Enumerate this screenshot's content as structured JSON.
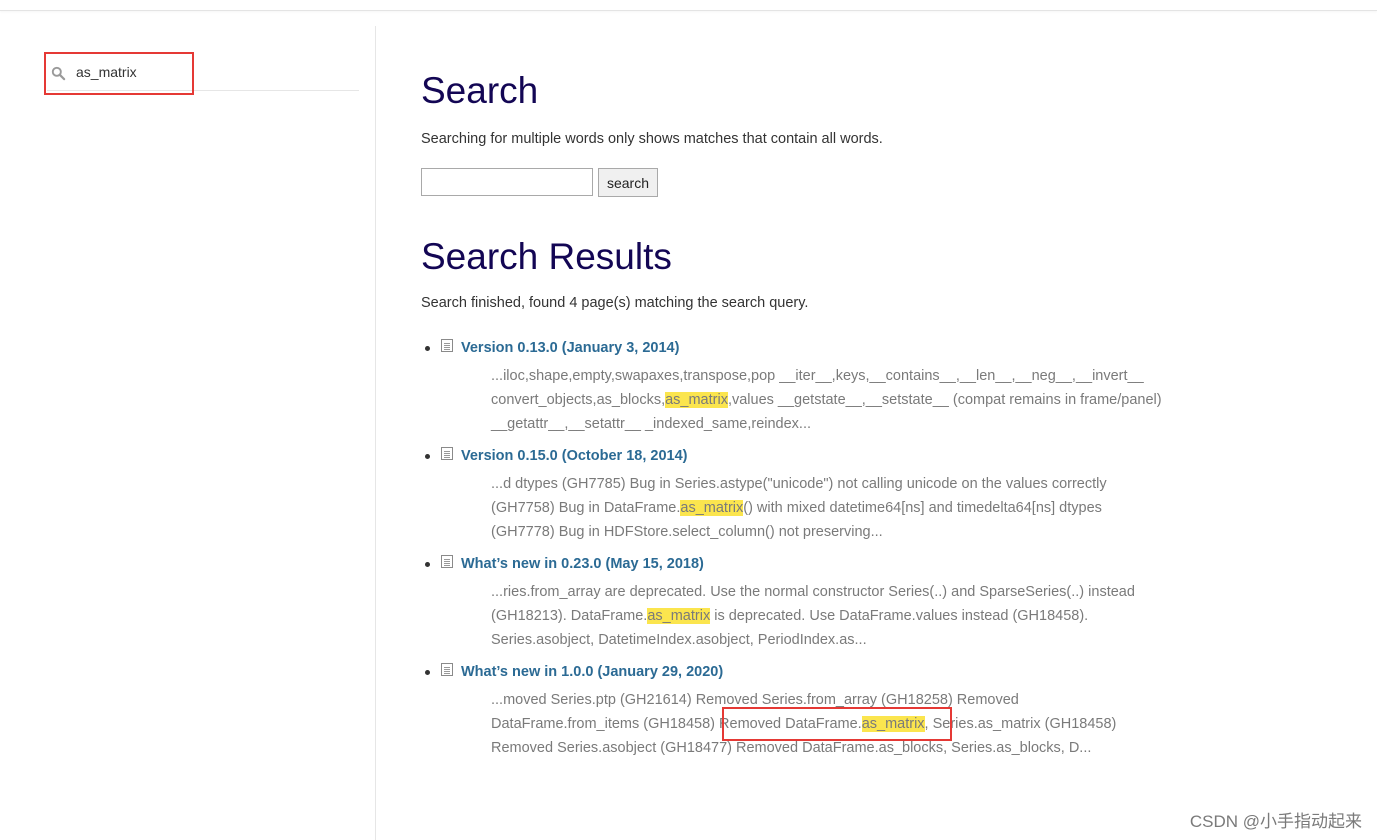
{
  "sidebar": {
    "search_value": "as_matrix"
  },
  "main": {
    "title": "Search",
    "hint": "Searching for multiple words only shows matches that contain all words.",
    "search_input_value": "",
    "search_button": "search",
    "results_title": "Search Results",
    "status": "Search finished, found 4 page(s) matching the search query.",
    "results": [
      {
        "title": "Version 0.13.0 (January 3, 2014)",
        "line1": "...iloc,shape,empty,swapaxes,transpose,pop __iter__,keys,__contains__,__len__,__neg__,__invert__",
        "line2_pre": "convert_objects,as_blocks,",
        "line2_hl": "as_matrix",
        "line2_post": ",values __getstate__,__setstate__ (compat remains in frame/panel)",
        "line3": "__getattr__,__setattr__ _indexed_same,reindex..."
      },
      {
        "title": "Version 0.15.0 (October 18, 2014)",
        "line1": "...d dtypes (GH7785) Bug in Series.astype(\"unicode\") not calling unicode on the values correctly",
        "line2_pre": "(GH7758) Bug in DataFrame.",
        "line2_hl": "as_matrix",
        "line2_post": "() with mixed datetime64[ns] and timedelta64[ns] dtypes",
        "line3": "(GH7778) Bug in HDFStore.select_column() not preserving..."
      },
      {
        "title": "What’s new in 0.23.0 (May 15, 2018)",
        "line1": "...ries.from_array are deprecated. Use the normal constructor Series(..) and SparseSeries(..) instead",
        "line2_pre": "(GH18213). DataFrame.",
        "line2_hl": "as_matrix",
        "line2_post": " is deprecated. Use DataFrame.values instead (GH18458).",
        "line3": "Series.asobject, DatetimeIndex.asobject, PeriodIndex.as..."
      },
      {
        "title": "What’s new in 1.0.0 (January 29, 2020)",
        "line1": "...moved Series.ptp (GH21614) Removed Series.from_array (GH18258) Removed",
        "line2_pre": "DataFrame.from_items (GH18458) Removed DataFrame.",
        "line2_hl": "as_matrix",
        "line2_post": ", Series.as_matrix (GH18458)",
        "line3": "Removed Series.asobject (GH18477) Removed DataFrame.as_blocks, Series.as_blocks, D..."
      }
    ]
  },
  "watermark": "CSDN @小手指动起来",
  "colors": {
    "title": "#130654",
    "link": "#2b6a94",
    "highlight": "#fbe54e",
    "annotation_box": "#e53935"
  }
}
